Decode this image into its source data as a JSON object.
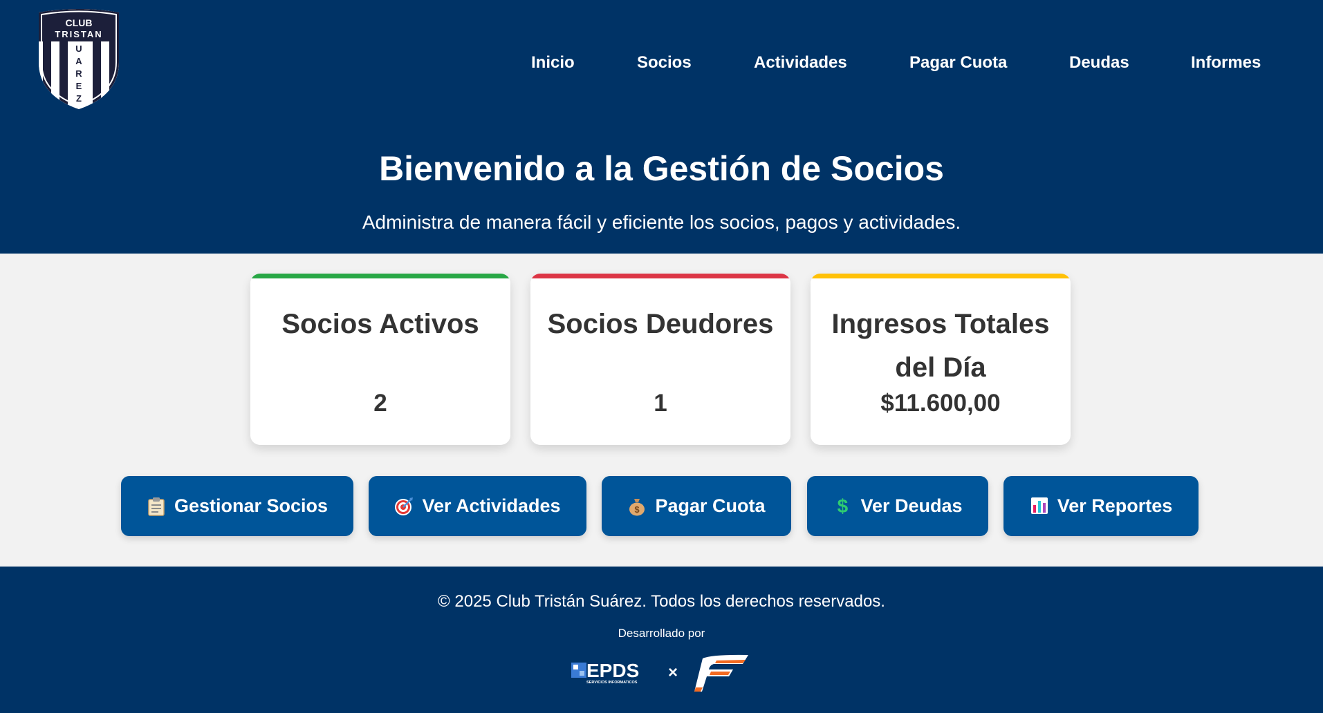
{
  "logo": {
    "line1": "CLUB",
    "line2": "TRISTAN",
    "vertical": [
      "U",
      "A",
      "R",
      "E",
      "Z"
    ]
  },
  "nav": {
    "items": [
      {
        "label": "Inicio"
      },
      {
        "label": "Socios"
      },
      {
        "label": "Actividades"
      },
      {
        "label": "Pagar Cuota"
      },
      {
        "label": "Deudas"
      },
      {
        "label": "Informes"
      }
    ]
  },
  "hero": {
    "title": "Bienvenido a la Gestión de Socios",
    "subtitle": "Administra de manera fácil y eficiente los socios, pagos y actividades."
  },
  "stats": [
    {
      "title": "Socios Activos",
      "value": "2",
      "accent": "#28a745"
    },
    {
      "title": "Socios Deudores",
      "value": "1",
      "accent": "#dc3545"
    },
    {
      "title": "Ingresos Totales del Día",
      "value": "$11.600,00",
      "accent": "#ffc107"
    }
  ],
  "actions": [
    {
      "icon": "clipboard-icon",
      "label": "Gestionar Socios"
    },
    {
      "icon": "target-icon",
      "label": "Ver Actividades"
    },
    {
      "icon": "money-bag-icon",
      "label": "Pagar Cuota"
    },
    {
      "icon": "dollar-sign-icon",
      "label": "Ver Deudas"
    },
    {
      "icon": "bar-chart-icon",
      "label": "Ver Reportes"
    }
  ],
  "footer": {
    "copyright": "© 2025 Club Tristán Suárez. Todos los derechos reservados.",
    "developed_by": "Desarrollado por",
    "brand1": "EPDS",
    "brand1_sub": "SERVICIOS INFORMATICOS",
    "separator": "×"
  },
  "colors": {
    "header_bg": "#003366",
    "button_bg": "#005599",
    "page_bg": "#f2f2f2"
  }
}
